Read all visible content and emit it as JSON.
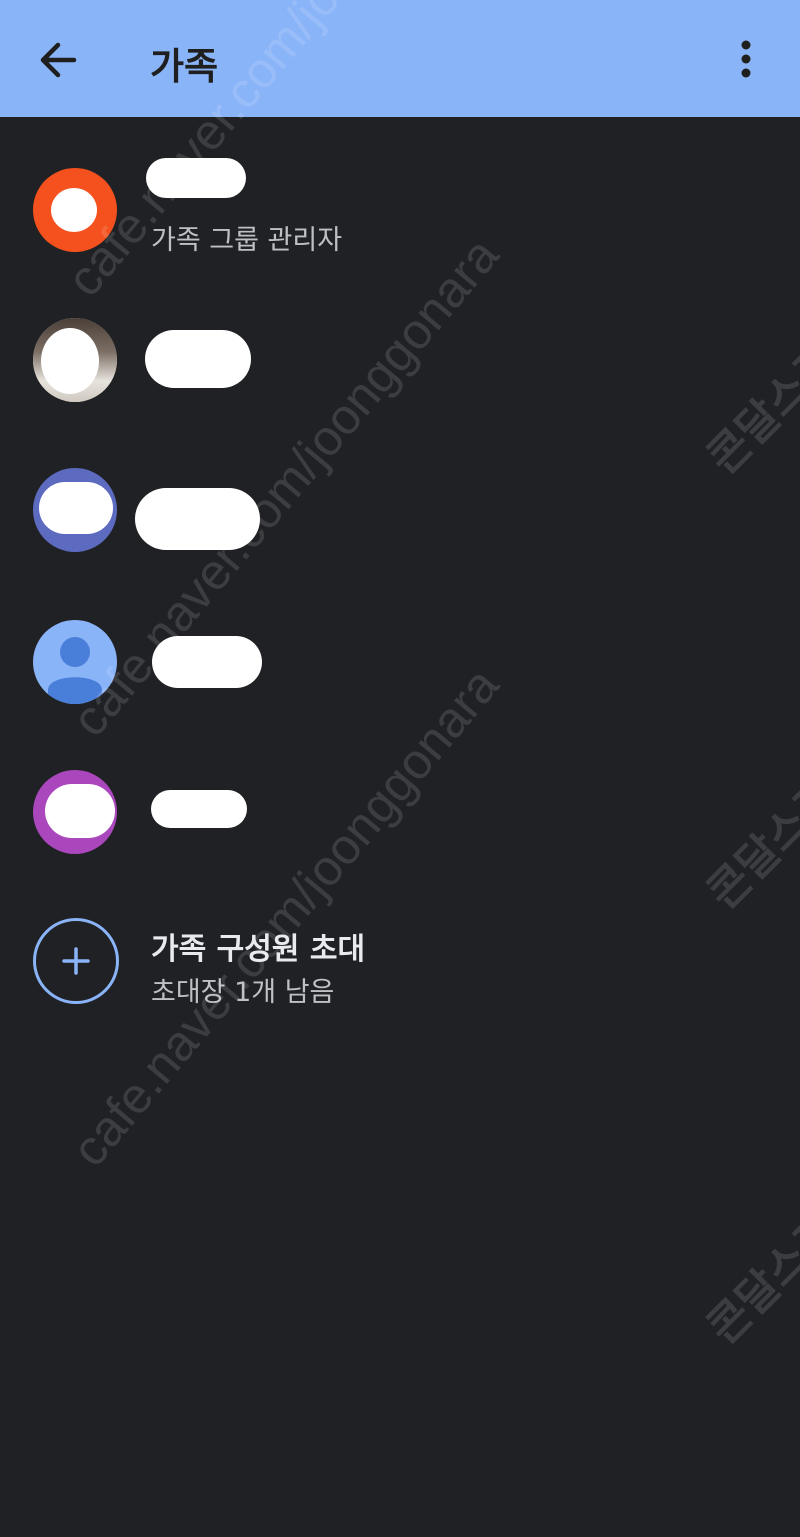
{
  "appbar": {
    "title": "가족",
    "back_icon": "arrow-left-icon",
    "more_icon": "more-vert-icon",
    "color": "#8ab4f8"
  },
  "members": [
    {
      "subtitle": "가족 그룹 관리자",
      "avatar_color": "#f4511e"
    },
    {
      "subtitle": "",
      "avatar_color": "#d9d4cc"
    },
    {
      "subtitle": "",
      "avatar_color": "#5c6bc0"
    },
    {
      "subtitle": "",
      "avatar_color": "#8ab4f8"
    },
    {
      "subtitle": "",
      "avatar_color": "#ab47bc"
    }
  ],
  "invite": {
    "title": "가족 구성원 초대",
    "subtitle": "초대장 1개 남음",
    "icon": "plus-icon"
  },
  "watermarks": {
    "cafe": "cafe.naver.com/joonggonara",
    "kor": "콘달스포츠"
  }
}
